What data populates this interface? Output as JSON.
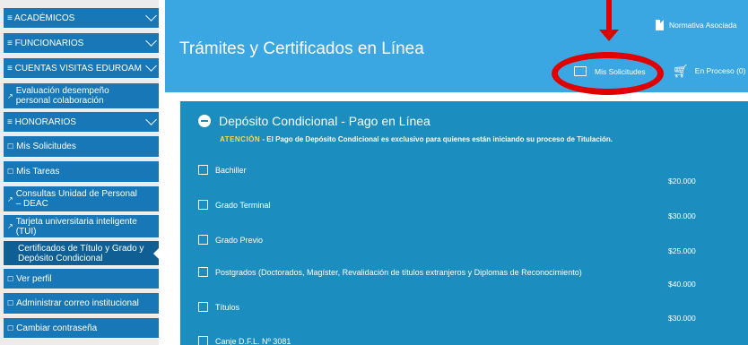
{
  "sidebar": {
    "items": [
      {
        "label": "≡ ACADÉMICOS"
      },
      {
        "label": "≡ FUNCIONARIOS"
      },
      {
        "label": "≡ CUENTAS VISITAS EDUROAM"
      },
      {
        "label": "Evaluación desempeño personal colaboración"
      },
      {
        "label": "≡ HONORARIOS"
      },
      {
        "label": "Mis Solicitudes"
      },
      {
        "label": "Mis Tareas"
      },
      {
        "label": "Consultas Unidad de Personal – DEAC"
      },
      {
        "label": "Tarjeta universitaria inteligente (TUI)"
      },
      {
        "label": "Certificados de Título y Grado y Depósito Condicional"
      },
      {
        "label": "Ver perfil"
      },
      {
        "label": "Administrar correo institucional"
      },
      {
        "label": "Cambiar contraseña"
      }
    ]
  },
  "header": {
    "title": "Trámites y Certificados en Línea",
    "normativa": "Normativa Asociada",
    "mis_solicitudes": "Mis Solicitudes",
    "en_proceso": "En Proceso (0)"
  },
  "section": {
    "title": "Depósito Condicional - Pago en Línea",
    "notice_label": "ATENCIÓN",
    "notice_text": " - El Pago de Depósito Condicional es exclusivo para quienes están iniciando su proceso de Titulación."
  },
  "options": [
    {
      "label": "Bachiller",
      "price": "$20.000"
    },
    {
      "label": "Grado Terminal",
      "price": "$30.000"
    },
    {
      "label": "Grado Previo",
      "price": "$25.000"
    },
    {
      "label": "Postgrados (Doctorados, Magíster, Revalidación de títulos extranjeros y Diplomas de Reconocimiento)",
      "price": "$40.000"
    },
    {
      "label": "Títulos",
      "price": "$30.000"
    },
    {
      "label": "Canje D.F.L. Nº 3081",
      "price": ""
    }
  ],
  "colors": {
    "sidebar_blue": "#1877b6",
    "header_blue": "#3aa7e2",
    "panel_blue": "#1b8dbf",
    "warning_yellow": "#ffd84a",
    "annotation_red": "#e00000"
  }
}
